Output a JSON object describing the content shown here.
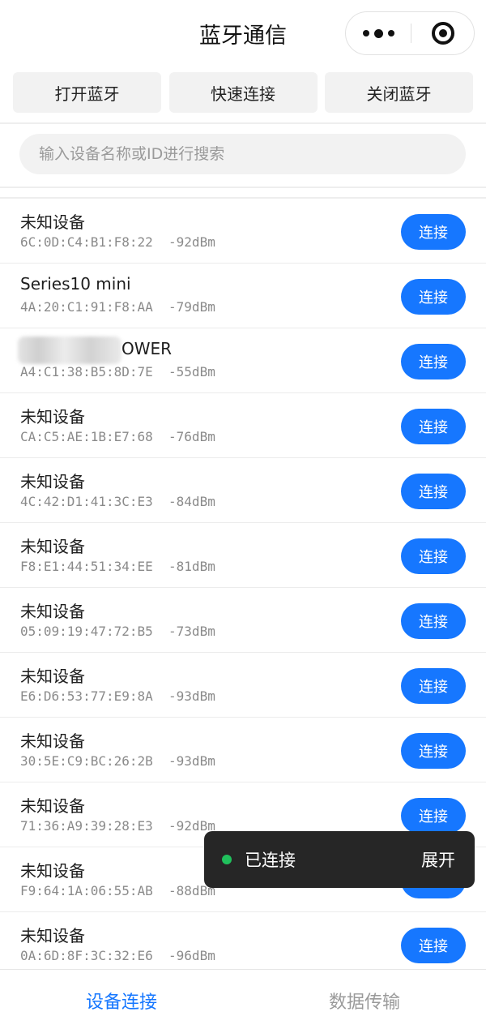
{
  "nav": {
    "title": "蓝牙通信",
    "more_icon": "more-dots-icon",
    "close_icon": "target-circle-icon"
  },
  "toolbar": {
    "open": "打开蓝牙",
    "quick": "快速连接",
    "close": "关闭蓝牙"
  },
  "search": {
    "placeholder": "输入设备名称或ID进行搜索",
    "value": ""
  },
  "devices": [
    {
      "name": "未知设备",
      "mac": "6C:0D:C4:B1:F8:22",
      "rssi": "-92dBm",
      "action": "连接"
    },
    {
      "name": "Series10 mini",
      "mac": "4A:20:C1:91:F8:AA",
      "rssi": "-79dBm",
      "action": "连接"
    },
    {
      "name": "OWER",
      "mac": "A4:C1:38:B5:8D:7E",
      "rssi": "-55dBm",
      "action": "连接"
    },
    {
      "name": "未知设备",
      "mac": "CA:C5:AE:1B:E7:68",
      "rssi": "-76dBm",
      "action": "连接"
    },
    {
      "name": "未知设备",
      "mac": "4C:42:D1:41:3C:E3",
      "rssi": "-84dBm",
      "action": "连接"
    },
    {
      "name": "未知设备",
      "mac": "F8:E1:44:51:34:EE",
      "rssi": "-81dBm",
      "action": "连接"
    },
    {
      "name": "未知设备",
      "mac": "05:09:19:47:72:B5",
      "rssi": "-73dBm",
      "action": "连接"
    },
    {
      "name": "未知设备",
      "mac": "E6:D6:53:77:E9:8A",
      "rssi": "-93dBm",
      "action": "连接"
    },
    {
      "name": "未知设备",
      "mac": "30:5E:C9:BC:26:2B",
      "rssi": "-93dBm",
      "action": "连接"
    },
    {
      "name": "未知设备",
      "mac": "71:36:A9:39:28:E3",
      "rssi": "-92dBm",
      "action": "连接"
    },
    {
      "name": "未知设备",
      "mac": "F9:64:1A:06:55:AB",
      "rssi": "-88dBm",
      "action": "连接"
    },
    {
      "name": "未知设备",
      "mac": "0A:6D:8F:3C:32:E6",
      "rssi": "-96dBm",
      "action": "连接"
    }
  ],
  "toast": {
    "status": "已连接",
    "expand": "展开",
    "status_color": "#20c05c"
  },
  "tabbar": {
    "tabs": [
      {
        "label": "设备连接"
      },
      {
        "label": "数据传输"
      }
    ]
  },
  "colors": {
    "accent": "#1677ff",
    "toast_bg": "#262626"
  }
}
